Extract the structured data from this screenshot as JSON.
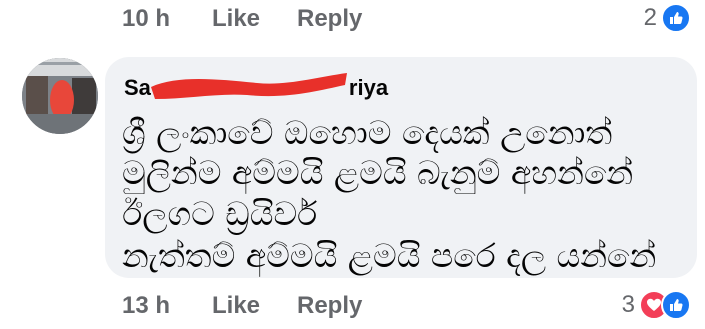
{
  "top_actions": {
    "time": "10 h",
    "like_label": "Like",
    "reply_label": "Reply",
    "reaction_count": "2",
    "reaction_icons": [
      "like-icon"
    ]
  },
  "comment": {
    "author_visible_start": "Sa",
    "author_visible_end": "riya",
    "avatar": "profile-photo",
    "lines": [
      "ශ්‍රී ලංකාවේ ඔහොම දෙයක් උනොත්",
      "මුලින්ම අම්මයි ළමයි බැනුම් අහන්නේ",
      "ඊලගට ඩ්‍රයිවර්",
      "නැත්තම් අම්මයි ළමයි පරෙ දල යන්නේ"
    ]
  },
  "bottom_actions": {
    "time": "13 h",
    "like_label": "Like",
    "reply_label": "Reply",
    "reaction_count": "3",
    "reaction_icons": [
      "love-icon",
      "like-icon"
    ]
  },
  "colors": {
    "bubble_bg": "#f0f2f5",
    "meta_text": "#65676b",
    "like_blue": "#1877f2",
    "love_red": "#f33e58",
    "redaction": "#e8302a"
  }
}
